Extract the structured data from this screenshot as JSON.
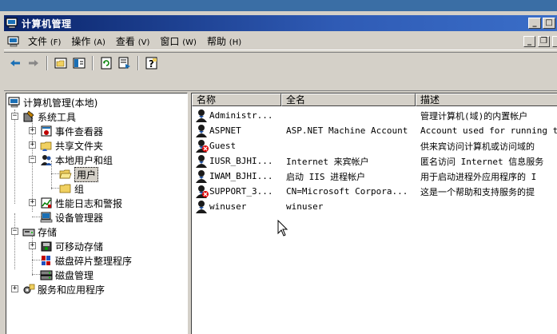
{
  "window": {
    "title": "计算机管理"
  },
  "menu": [
    {
      "label": "文件",
      "accel": "(F)"
    },
    {
      "label": "操作",
      "accel": "(A)"
    },
    {
      "label": "查看",
      "accel": "(V)"
    },
    {
      "label": "窗口",
      "accel": "(W)"
    },
    {
      "label": "帮助",
      "accel": "(H)"
    }
  ],
  "tree": {
    "root": "计算机管理(本地)",
    "system_tools": "系统工具",
    "event_viewer": "事件查看器",
    "shared_folders": "共享文件夹",
    "local_users": "本地用户和组",
    "users": "用户",
    "groups": "组",
    "perf_logs": "性能日志和警报",
    "device_manager": "设备管理器",
    "storage": "存储",
    "removable_storage": "可移动存储",
    "disk_defrag": "磁盘碎片整理程序",
    "disk_mgmt": "磁盘管理",
    "services_apps": "服务和应用程序"
  },
  "columns": {
    "name": "名称",
    "fullname": "全名",
    "description": "描述"
  },
  "users": [
    {
      "name": "Administr...",
      "fullname": "",
      "description": "管理计算机(域)的内置帐户",
      "disabled": false
    },
    {
      "name": "ASPNET",
      "fullname": "ASP.NET Machine Account",
      "description": "Account used for running t",
      "disabled": false
    },
    {
      "name": "Guest",
      "fullname": "",
      "description": "供来宾访问计算机或访问域的",
      "disabled": true
    },
    {
      "name": "IUSR_BJHI...",
      "fullname": "Internet 来宾帐户",
      "description": "匿名访问 Internet 信息服务",
      "disabled": false
    },
    {
      "name": "IWAM_BJHI...",
      "fullname": "启动 IIS 进程帐户",
      "description": "用于启动进程外应用程序的 I",
      "disabled": false
    },
    {
      "name": "SUPPORT_3...",
      "fullname": "CN=Microsoft Corpora...",
      "description": "这是一个帮助和支持服务的提",
      "disabled": true
    },
    {
      "name": "winuser",
      "fullname": "winuser",
      "description": "",
      "disabled": false
    }
  ]
}
